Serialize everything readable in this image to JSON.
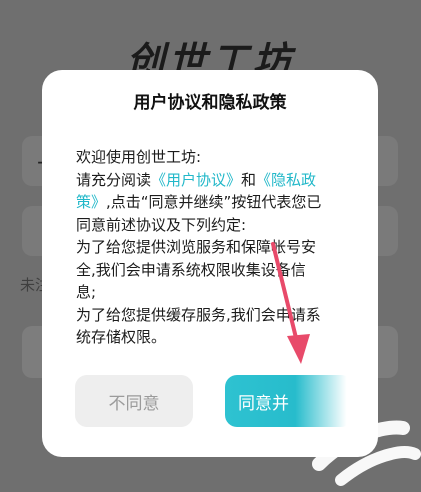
{
  "background": {
    "logo_text": "创世工坊",
    "plus_symbol": "+",
    "side_text": "未注"
  },
  "dialog": {
    "title": "用户协议和隐私政策",
    "body": {
      "line1": "欢迎使用创世工坊:",
      "line2_pre": "请充分阅读",
      "user_agreement_link": "《用户协议》",
      "and": "和",
      "privacy_link_part1": "《隐私政",
      "privacy_link_part2": "策》",
      "line3_rest": ",点击“同意并继续”按钮代表您已",
      "line4": "同意前述协议及下列约定:",
      "line5": "为了给您提供浏览服务和保障帐号安",
      "line6": "全,我们会申请系统权限收集设备信",
      "line7": "息;",
      "line8": "为了给您提供缓存服务,我们会申请系",
      "line9": "统存储权限。"
    },
    "disagree_label": "不同意",
    "agree_label": "同意并"
  },
  "colors": {
    "overlay": "#6f6f6f",
    "link": "#22b8c9",
    "agree_button": "#2ec2d1",
    "disagree_button": "#eeeeee",
    "annotation_arrow": "#e84a6a"
  }
}
